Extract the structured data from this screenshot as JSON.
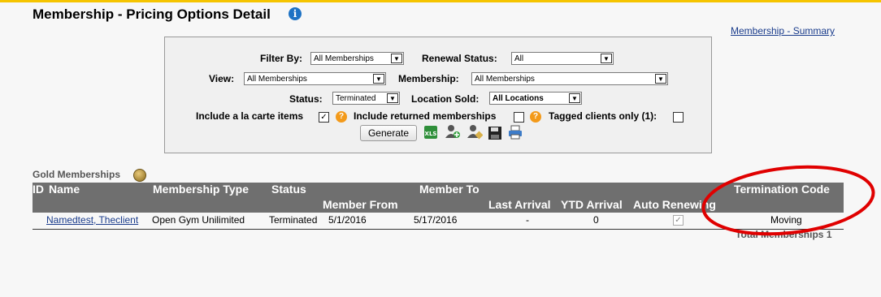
{
  "page": {
    "title": "Membership - Pricing Options Detail",
    "summary_link": "Membership - Summary"
  },
  "filters": {
    "filter_by_label": "Filter By:",
    "filter_by_value": "All Memberships",
    "renewal_status_label": "Renewal Status:",
    "renewal_status_value": "All",
    "view_label": "View:",
    "view_value": "All Memberships",
    "membership_label": "Membership:",
    "membership_value": "All Memberships",
    "status_label": "Status:",
    "status_value": "Terminated",
    "location_sold_label": "Location Sold:",
    "location_sold_value": "All Locations",
    "include_a_la_carte_label": "Include a la carte items",
    "include_a_la_carte_checked": true,
    "include_returned_label": "Include returned memberships",
    "include_returned_checked": false,
    "tagged_clients_label": "Tagged clients only (1):",
    "tagged_clients_checked": false,
    "generate_label": "Generate"
  },
  "section": {
    "title": "Gold Memberships"
  },
  "table": {
    "headers": {
      "id": "ID",
      "name": "Name",
      "membership_type": "Membership Type",
      "status": "Status",
      "member_to": "Member To",
      "termination_code": "Termination Code",
      "member_from": "Member From",
      "last_arrival": "Last Arrival",
      "ytd_arrival": "YTD Arrival",
      "auto_renewing": "Auto Renewing"
    },
    "rows": [
      {
        "name": "Namedtest, Theclient",
        "membership_type": "Open Gym Unilimited",
        "status": "Terminated",
        "member_from": "5/1/2016",
        "member_to": "5/17/2016",
        "last_arrival": "-",
        "ytd_arrival": "0",
        "auto_renewing": true,
        "termination_code": "Moving"
      }
    ],
    "total_label": "Total Memberships",
    "total_value": "1"
  },
  "colors": {
    "accent_bar": "#f5c400",
    "header_bg": "#6f6f6f",
    "link": "#1a3c8c",
    "annotation": "#e00000"
  },
  "icons": [
    "info-icon",
    "help-icon",
    "gold-coin-icon",
    "xls-export-icon",
    "add-user-icon",
    "tag-user-icon",
    "save-icon",
    "print-icon",
    "checkmark-icon"
  ]
}
